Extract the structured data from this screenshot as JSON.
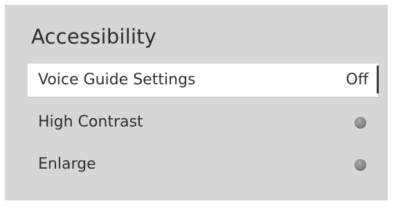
{
  "panel": {
    "title": "Accessibility"
  },
  "menu": {
    "items": [
      {
        "label": "Voice Guide Settings",
        "value": "Off",
        "selected": true
      },
      {
        "label": "High Contrast",
        "toggle": "off",
        "icon": "toggle-off-icon"
      },
      {
        "label": "Enlarge",
        "toggle": "off",
        "icon": "toggle-off-icon"
      }
    ]
  },
  "colors": {
    "panel_background": "#d6d6d6",
    "selected_background": "#ffffff",
    "text": "#2e2e2e",
    "toggle_off": "#868686"
  }
}
